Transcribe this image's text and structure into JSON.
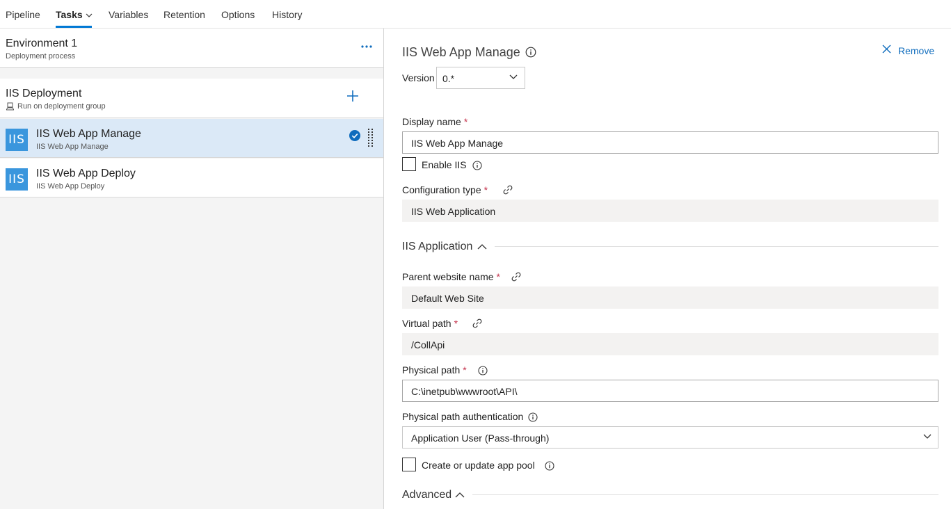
{
  "tabs": [
    {
      "label": "Pipeline"
    },
    {
      "label": "Tasks"
    },
    {
      "label": "Variables"
    },
    {
      "label": "Retention"
    },
    {
      "label": "Options"
    },
    {
      "label": "History"
    }
  ],
  "environment": {
    "title": "Environment 1",
    "subtitle": "Deployment process"
  },
  "phase": {
    "title": "IIS Deployment",
    "subtitle": "Run on deployment group"
  },
  "tasks": [
    {
      "icon_text": "IIS",
      "title": "IIS Web App Manage",
      "subtitle": "IIS Web App Manage",
      "selected": true
    },
    {
      "icon_text": "IIS",
      "title": "IIS Web App Deploy",
      "subtitle": "IIS Web App Deploy",
      "selected": false
    }
  ],
  "details": {
    "title": "IIS Web App Manage",
    "remove_label": "Remove",
    "version_label": "Version",
    "version_value": "0.*",
    "display_name_label": "Display name",
    "display_name_value": "IIS Web App Manage",
    "enable_iis_label": "Enable IIS",
    "config_type_label": "Configuration type",
    "config_type_value": "IIS Web Application",
    "iis_app_section": "IIS Application",
    "parent_site_label": "Parent website name",
    "parent_site_value": "Default Web Site",
    "virtual_path_label": "Virtual path",
    "virtual_path_value": "/CollApi",
    "physical_path_label": "Physical path",
    "physical_path_value": "C:\\inetpub\\wwwroot\\API\\",
    "physical_auth_label": "Physical path authentication",
    "physical_auth_value": "Application User (Pass-through)",
    "app_pool_label": "Create or update app pool",
    "advanced_section": "Advanced",
    "required_marker": "*"
  },
  "colors": {
    "accent": "#0078d4",
    "selected_row": "#dbe9f7",
    "task_icon": "#3a96dd",
    "required": "#c4314b"
  }
}
